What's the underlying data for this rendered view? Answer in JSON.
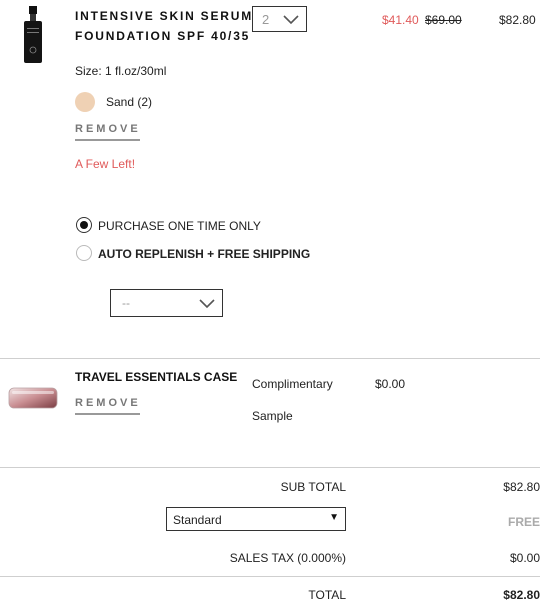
{
  "cart": {
    "items": [
      {
        "title": "INTENSIVE SKIN SERUM FOUNDATION SPF 40/35",
        "quantity": "2",
        "sale_price": "$41.40",
        "original_price": "$69.00",
        "line_total": "$82.80",
        "size": "Size: 1 fl.oz/30ml",
        "shade": "Sand (2)",
        "shade_color": "#efd1b4",
        "remove_label": "REMOVE",
        "stock_message": "A Few Left!",
        "purchase_options": [
          {
            "label": "PURCHASE ONE TIME ONLY",
            "selected": true
          },
          {
            "label": "AUTO REPLENISH + FREE SHIPPING",
            "selected": false
          }
        ],
        "replenish_frequency": "--"
      },
      {
        "title": "TRAVEL ESSENTIALS CASE",
        "remove_label": "REMOVE",
        "note_line1": "Complimentary",
        "note_line2": "Sample",
        "price": "$0.00"
      }
    ]
  },
  "summary": {
    "subtotal_label": "SUB TOTAL",
    "subtotal_value": "$82.80",
    "shipping_method": "Standard",
    "shipping_value": "FREE",
    "tax_label": "SALES TAX (0.000%)",
    "tax_value": "$0.00",
    "total_label": "TOTAL",
    "total_value": "$82.80"
  },
  "colors": {
    "sale_red": "#e05a5a",
    "divider": "#cfcfcf"
  }
}
